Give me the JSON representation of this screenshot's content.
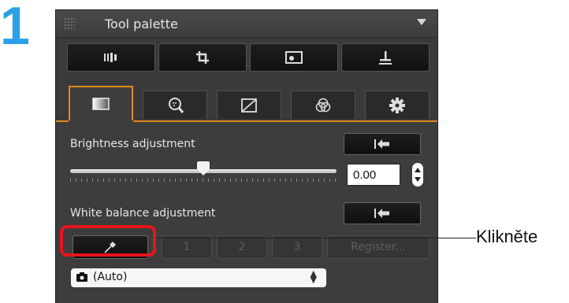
{
  "step": {
    "number": "1"
  },
  "palette": {
    "title": "Tool palette",
    "toolbar": [
      {
        "icon": "compare-layout-icon"
      },
      {
        "icon": "crop-icon"
      },
      {
        "icon": "dust-delete-icon"
      },
      {
        "icon": "stamp-icon"
      }
    ],
    "tabs": [
      {
        "icon": "basic-adjustment-icon",
        "active": true
      },
      {
        "icon": "sharpness-magnifier-icon",
        "active": false
      },
      {
        "icon": "tone-curve-icon",
        "active": false
      },
      {
        "icon": "color-adjustment-icon",
        "active": false
      },
      {
        "icon": "settings-gear-icon",
        "active": false
      }
    ],
    "brightness": {
      "label": "Brightness adjustment",
      "value": "0.00",
      "slider_fraction": 0.5
    },
    "white_balance": {
      "label": "White balance adjustment",
      "slots": [
        "1",
        "2",
        "3",
        "Register..."
      ],
      "preset": "(Auto)"
    }
  },
  "callout": {
    "text": "Klikněte"
  },
  "colors": {
    "accent": "#e08a1e",
    "highlight": "#e8141b",
    "step": "#2aa0e6",
    "panel": "#3d3d3d"
  }
}
